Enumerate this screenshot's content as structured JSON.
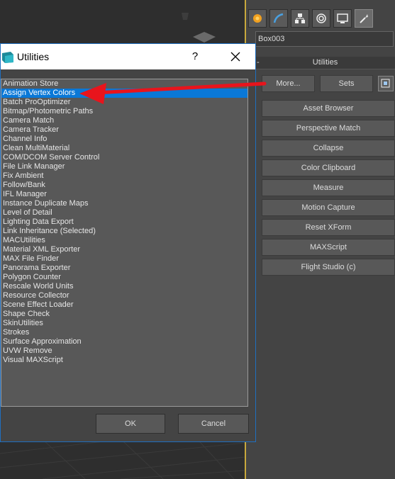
{
  "dialog": {
    "title": "Utilities",
    "help_label": "?",
    "items": [
      "Animation Store",
      "Assign Vertex Colors",
      "Batch ProOptimizer",
      "Bitmap/Photometric Paths",
      "Camera Match",
      "Camera Tracker",
      "Channel Info",
      "Clean MultiMaterial",
      "COM/DCOM Server Control",
      "File Link Manager",
      "Fix Ambient",
      "Follow/Bank",
      "IFL Manager",
      "Instance Duplicate Maps",
      "Level of Detail",
      "Lighting Data Export",
      "Link Inheritance (Selected)",
      "MACUtilities",
      "Material XML Exporter",
      "MAX File Finder",
      "Panorama Exporter",
      "Polygon Counter",
      "Rescale World Units",
      "Resource Collector",
      "Scene Effect Loader",
      "Shape Check",
      "SkinUtilities",
      "Strokes",
      "Surface Approximation",
      "UVW Remove",
      "Visual MAXScript"
    ],
    "selected_item": "Assign Vertex Colors",
    "ok_label": "OK",
    "cancel_label": "Cancel"
  },
  "panel": {
    "object_name": "Box003",
    "rollout_minus": "-",
    "rollout_title": "Utilities",
    "more_label": "More...",
    "sets_label": "Sets",
    "buttons": [
      "Asset Browser",
      "Perspective Match",
      "Collapse",
      "Color Clipboard",
      "Measure",
      "Motion Capture",
      "Reset XForm",
      "MAXScript",
      "Flight Studio (c)"
    ],
    "tabs": [
      "create-icon",
      "modify-icon",
      "hierarchy-icon",
      "motion-icon",
      "display-icon",
      "utilities-icon"
    ]
  },
  "colors": {
    "selection": "#0a78d7",
    "annotation_arrow": "#e8141c",
    "viewport_border": "#c8a83c",
    "dialog_border": "#1f6fc0"
  }
}
